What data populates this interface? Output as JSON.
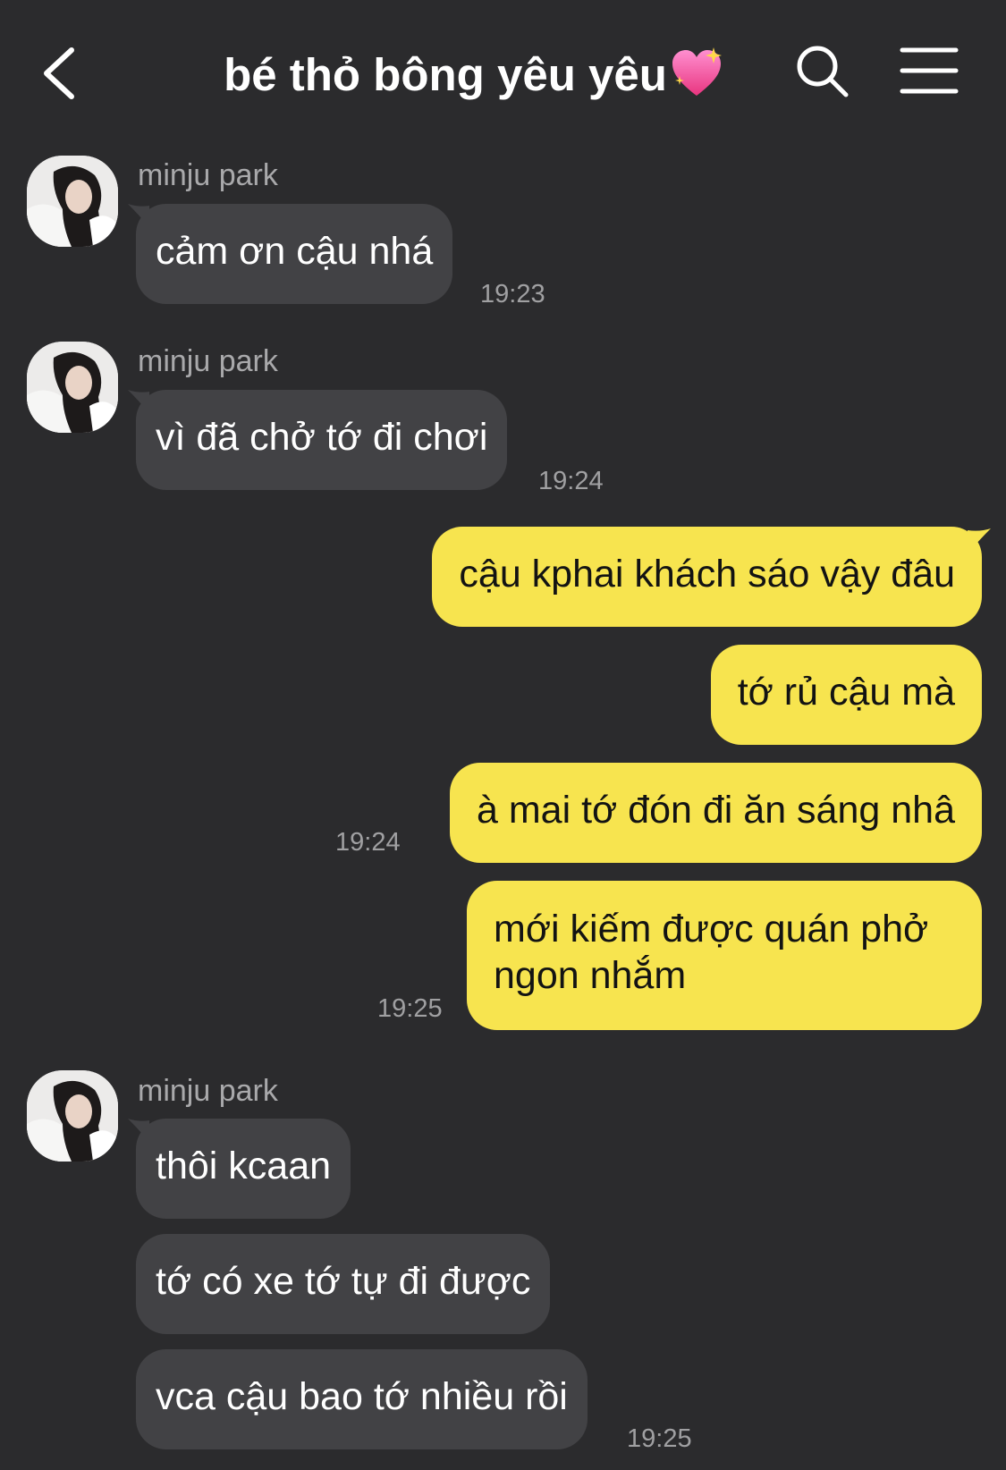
{
  "header": {
    "title": "bé thỏ bông yêu yêu",
    "title_emoji": "sparkling-heart-icon",
    "back_icon": "chevron-left-icon",
    "search_icon": "search-icon",
    "menu_icon": "hamburger-menu-icon"
  },
  "colors": {
    "background": "#2b2b2d",
    "incoming_bubble": "#424245",
    "outgoing_bubble": "#f7e44f"
  },
  "messages": [
    {
      "sender": "minju park",
      "text": "cảm ơn cậu nhá",
      "time": "19:23"
    },
    {
      "sender": "minju park",
      "text": "vì đã chở tớ đi chơi",
      "time": "19:24"
    },
    {
      "text": "cậu kphai khách sáo vậy đâu"
    },
    {
      "text": "tớ rủ cậu mà"
    },
    {
      "text": "à mai tớ đón đi ăn sáng nhâ",
      "time": "19:24"
    },
    {
      "text": "mới kiếm được quán phở ngon nhắm",
      "time": "19:25"
    },
    {
      "sender": "minju park",
      "text": "thôi kcaan"
    },
    {
      "text": "tớ có xe tớ tự đi được"
    },
    {
      "text": "vca cậu bao tớ nhiều rồi",
      "time": "19:25"
    }
  ]
}
